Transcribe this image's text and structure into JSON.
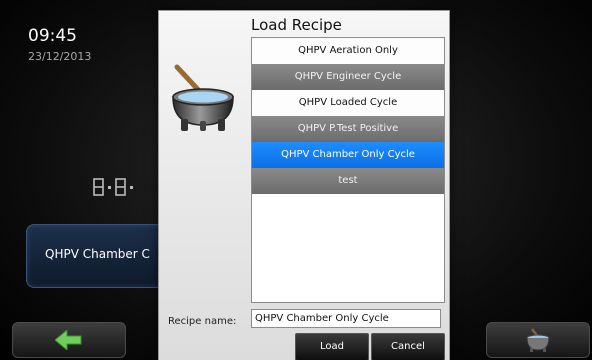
{
  "background": {
    "time": "09:45",
    "date": "23/12/2013",
    "cycle_button_label": "QHPV Chamber C"
  },
  "dialog": {
    "title": "Load Recipe",
    "recipes": [
      {
        "label": "QHPV Aeration Only",
        "style": "light"
      },
      {
        "label": "QHPV Engineer Cycle",
        "style": "dark"
      },
      {
        "label": "QHPV Loaded Cycle",
        "style": "light"
      },
      {
        "label": "QHPV P.Test Positive",
        "style": "dark"
      },
      {
        "label": "QHPV Chamber Only Cycle",
        "style": "sel"
      },
      {
        "label": "test",
        "style": "dark"
      }
    ],
    "recipe_name_label": "Recipe name:",
    "recipe_name_value": "QHPV Chamber Only Cycle",
    "load_label": "Load",
    "cancel_label": "Cancel"
  },
  "icons": {
    "back": "back-arrow-icon",
    "recipe_pot": "cauldron-icon"
  },
  "colors": {
    "selection": "#0b6fe6",
    "back_arrow": "#6fcf5a"
  }
}
